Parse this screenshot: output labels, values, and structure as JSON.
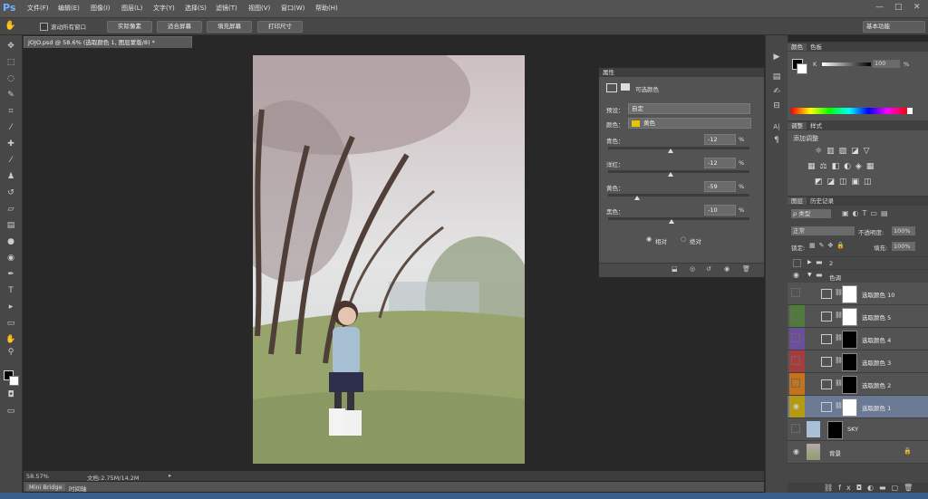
{
  "app": {
    "logo": "Ps"
  },
  "menu": [
    "文件(F)",
    "编辑(E)",
    "图像(I)",
    "图层(L)",
    "文字(Y)",
    "选择(S)",
    "滤镜(T)",
    "视图(V)",
    "窗口(W)",
    "帮助(H)"
  ],
  "window_controls": [
    "—",
    "□",
    "✕"
  ],
  "options": {
    "scroll_all": "滚动所有窗口",
    "buttons": [
      "实际像素",
      "适合屏幕",
      "填充屏幕",
      "打印尺寸"
    ],
    "workspace": "基本功能"
  },
  "document": {
    "tab_title": "JOJO.psd @ 58.6% (选取颜色 1, 图层蒙版/8) *",
    "zoom": "58.57%",
    "doc_size": "文档:2.75M/14.2M",
    "mini_bridge": "Mini Bridge",
    "timeline": "时间轴"
  },
  "properties": {
    "tab": "属性",
    "title": "可选颜色",
    "preset_label": "预设：",
    "preset_value": "自定",
    "colors_label": "颜色：",
    "colors_value": "黄色",
    "colors_swatch": "#e8c400",
    "sliders": [
      {
        "label": "青色：",
        "value": "-12",
        "unit": "%",
        "level": 0.44
      },
      {
        "label": "洋红：",
        "value": "-12",
        "unit": "%",
        "level": 0.44
      },
      {
        "label": "黄色：",
        "value": "-59",
        "unit": "%",
        "level": 0.205
      },
      {
        "label": "黑色：",
        "value": "-10",
        "unit": "%",
        "level": 0.45
      }
    ],
    "method_relative": "相对",
    "method_absolute": "绝对"
  },
  "color_panel": {
    "tabs": [
      "颜色",
      "色板"
    ],
    "channel": "K",
    "value": "100",
    "unit": "%"
  },
  "adjust_panel": {
    "tabs": [
      "调整",
      "样式"
    ],
    "title": "添加调整"
  },
  "layers_panel": {
    "tabs": [
      "图层",
      "历史记录"
    ],
    "filter": "ρ 类型",
    "blend_mode": "正常",
    "opacity_label": "不透明度:",
    "opacity_value": "100%",
    "lock_label": "锁定:",
    "fill_label": "填充:",
    "fill_value": "100%",
    "groups": [
      {
        "name": "2"
      },
      {
        "name": "色调"
      }
    ],
    "layers": [
      {
        "name": "选取颜色 10",
        "color": "#535353",
        "mask": "#ffffff",
        "eye": ""
      },
      {
        "name": "选取颜色 5",
        "color": "#4f7a3b",
        "mask": "#ffffff",
        "eye": ""
      },
      {
        "name": "选取颜色 4",
        "color": "#6c4f9c",
        "mask": "#000000",
        "eye": ""
      },
      {
        "name": "选取颜色 3",
        "color": "#a83c3c",
        "mask": "#000000",
        "eye": ""
      },
      {
        "name": "选取颜色 2",
        "color": "#c2731b",
        "mask": "#000000",
        "eye": ""
      },
      {
        "name": "选取颜色 1",
        "color": "#b49a12",
        "mask": "#ffffff",
        "eye": "◉"
      },
      {
        "name": "SKY",
        "color": "#535353",
        "mask": "#000000",
        "eye": ""
      },
      {
        "name": "背景",
        "color": "#535353",
        "mask": "",
        "eye": "◉"
      }
    ]
  }
}
